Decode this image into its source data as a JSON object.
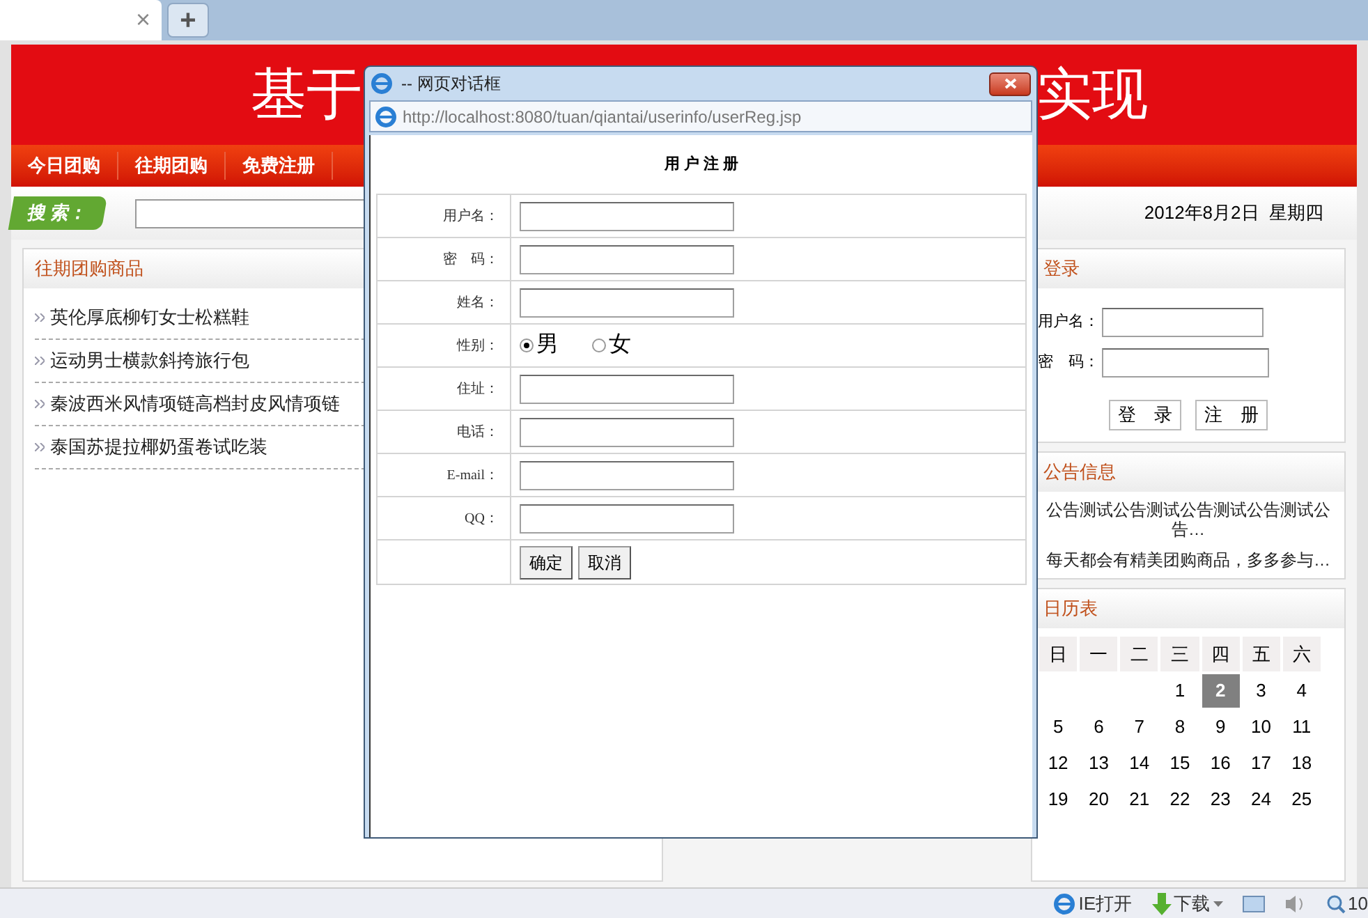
{
  "browser": {
    "tab_close": "×",
    "new_tab": "+"
  },
  "header": {
    "title_left": "基于",
    "title_right": "实现"
  },
  "nav": [
    {
      "label": "今日团购"
    },
    {
      "label": "往期团购"
    },
    {
      "label": "免费注册"
    }
  ],
  "search": {
    "label": "搜 索："
  },
  "date": "2012年8月2日  星期四",
  "past_deals": {
    "title": "往期团购商品",
    "items": [
      "英伦厚底柳钉女士松糕鞋",
      "运动男士横款斜挎旅行包",
      "秦波西米风情项链高档封皮风情项链",
      "泰国苏提拉椰奶蛋卷试吃装"
    ]
  },
  "login": {
    "title": "登录",
    "username_label": "用户名：",
    "password_label": "密　码：",
    "buttons": [
      "登　录",
      "注　册"
    ]
  },
  "notices": {
    "title": "公告信息",
    "items": [
      "公告测试公告测试公告测试公告测试公告…",
      "每天都会有精美团购商品，多多参与…"
    ]
  },
  "calendar": {
    "title": "日历表",
    "weekdays": [
      "日",
      "一",
      "二",
      "三",
      "四",
      "五",
      "六"
    ],
    "weeks": [
      [
        {
          "kind": "blank"
        },
        {
          "kind": "blank"
        },
        {
          "kind": "blank"
        },
        {
          "kind": "day",
          "label": "1",
          "selected": false
        },
        {
          "kind": "day",
          "label": "2",
          "selected": true
        },
        {
          "kind": "day",
          "label": "3",
          "selected": false
        },
        {
          "kind": "day",
          "label": "4",
          "selected": false
        }
      ],
      [
        {
          "kind": "day",
          "label": "5",
          "selected": false
        },
        {
          "kind": "day",
          "label": "6",
          "selected": false
        },
        {
          "kind": "day",
          "label": "7",
          "selected": false
        },
        {
          "kind": "day",
          "label": "8",
          "selected": false
        },
        {
          "kind": "day",
          "label": "9",
          "selected": false
        },
        {
          "kind": "day",
          "label": "10",
          "selected": false
        },
        {
          "kind": "day",
          "label": "11",
          "selected": false
        }
      ],
      [
        {
          "kind": "day",
          "label": "12",
          "selected": false
        },
        {
          "kind": "day",
          "label": "13",
          "selected": false
        },
        {
          "kind": "day",
          "label": "14",
          "selected": false
        },
        {
          "kind": "day",
          "label": "15",
          "selected": false
        },
        {
          "kind": "day",
          "label": "16",
          "selected": false
        },
        {
          "kind": "day",
          "label": "17",
          "selected": false
        },
        {
          "kind": "day",
          "label": "18",
          "selected": false
        }
      ],
      [
        {
          "kind": "day",
          "label": "19",
          "selected": false
        },
        {
          "kind": "day",
          "label": "20",
          "selected": false
        },
        {
          "kind": "day",
          "label": "21",
          "selected": false
        },
        {
          "kind": "day",
          "label": "22",
          "selected": false
        },
        {
          "kind": "day",
          "label": "23",
          "selected": false
        },
        {
          "kind": "day",
          "label": "24",
          "selected": false
        },
        {
          "kind": "day",
          "label": "25",
          "selected": false
        }
      ]
    ]
  },
  "dialog": {
    "title": "-- 网页对话框",
    "url": "http://localhost:8080/tuan/qiantai/userinfo/userReg.jsp",
    "heading": "用 户 注 册",
    "rows": [
      {
        "kind": "text",
        "label": "用户名："
      },
      {
        "kind": "text",
        "label": "密　码："
      },
      {
        "kind": "text",
        "label": "姓名："
      },
      {
        "kind": "radio",
        "label": "性别：",
        "options": [
          {
            "label": "男",
            "selected": true
          },
          {
            "label": "女",
            "selected": false
          }
        ]
      },
      {
        "kind": "text",
        "label": "住址："
      },
      {
        "kind": "text",
        "label": "电话："
      },
      {
        "kind": "text",
        "label": "E-mail："
      },
      {
        "kind": "text",
        "label": "QQ："
      }
    ],
    "buttons": [
      "确定",
      "取消"
    ]
  },
  "status_bar": {
    "open_in_ie": "IE打开",
    "download": "下载",
    "zoom": "10"
  }
}
